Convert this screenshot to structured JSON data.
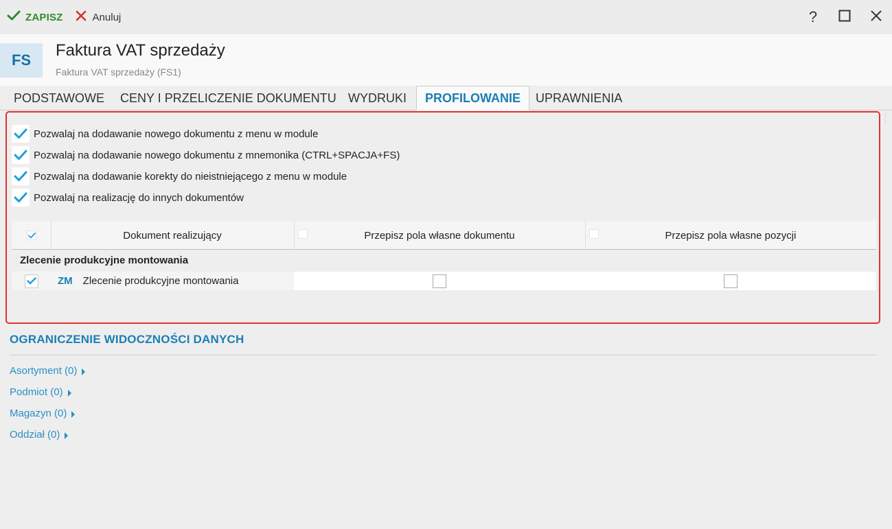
{
  "toolbar": {
    "save_label": "ZAPISZ",
    "cancel_label": "Anuluj",
    "help_label": "?"
  },
  "header": {
    "badge": "FS",
    "title": "Faktura VAT sprzedaży",
    "subtitle": "Faktura VAT sprzedaży (FS1)"
  },
  "tabs": [
    {
      "label": "PODSTAWOWE",
      "active": false
    },
    {
      "label": "CENY I PRZELICZENIE DOKUMENTU",
      "active": false
    },
    {
      "label": "WYDRUKI",
      "active": false
    },
    {
      "label": "PROFILOWANIE",
      "active": true
    },
    {
      "label": "UPRAWNIENIA",
      "active": false
    }
  ],
  "options": [
    {
      "label": "Pozwalaj na dodawanie nowego dokumentu z menu w module",
      "checked": true
    },
    {
      "label": "Pozwalaj na dodawanie nowego dokumentu z mnemonika (CTRL+SPACJA+FS)",
      "checked": true
    },
    {
      "label": "Pozwalaj na dodawanie korekty do nieistniejącego z menu w module",
      "checked": true
    },
    {
      "label": "Pozwalaj na realizację do innych dokumentów",
      "checked": true
    }
  ],
  "grid": {
    "columns": [
      "Dokument realizujący",
      "Przepisz pola własne dokumentu",
      "Przepisz pola własne pozycji"
    ],
    "group": "Zlecenie produkcyjne montowania",
    "rows": [
      {
        "code": "ZM",
        "name": "Zlecenie produkcyjne montowania",
        "selected": true,
        "copy_doc_fields": false,
        "copy_item_fields": false
      }
    ]
  },
  "visibility": {
    "title": "OGRANICZENIE WIDOCZNOŚCI DANYCH",
    "links": [
      "Asortyment (0)",
      "Podmiot (0)",
      "Magazyn (0)",
      "Oddział (0)"
    ]
  },
  "colors": {
    "accent": "#1a7fb5",
    "save_green": "#2e8b2e",
    "cancel_red": "#d9302c",
    "check_blue": "#1a9fd8",
    "highlight_red": "#e0332f"
  }
}
